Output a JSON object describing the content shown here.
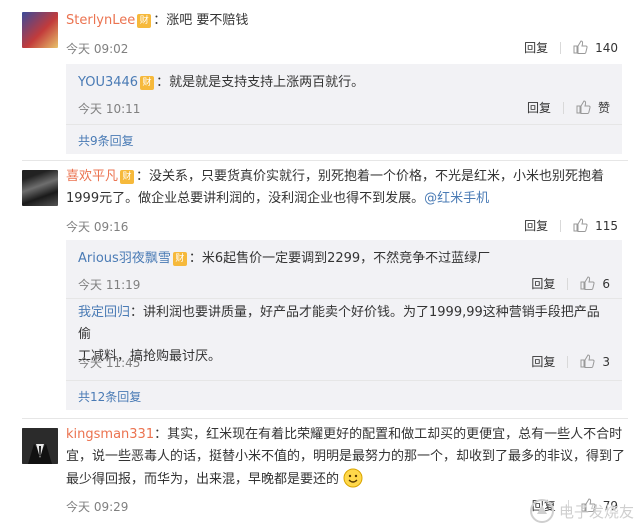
{
  "comments": [
    {
      "user": "SterlynLee",
      "text": "：涨吧 要不赔钱",
      "time": "今天 09:02",
      "reply": "回复",
      "likes": "140"
    },
    {
      "user": "喜欢平凡",
      "text_line1": "：没关系，只要货真价实就行，别死抱着一个价格，不光是红米，小米也别死抱着",
      "text_line2": "1999元了。做企业总要讲利润的，没利润企业也得不到发展。",
      "mention": "@红米手机",
      "time": "今天 09:16",
      "reply": "回复",
      "likes": "115"
    },
    {
      "user": "kingsman331",
      "text_line1": "：其实，红米现在有着比荣耀更好的配置和做工却买的更便宜，总有一些人不合时",
      "text_line2": "宜，说一些恶毒人的话，挺替小米不值的，明明是最努力的那一个，却收到了最多的非议，得到了",
      "text_line3": "最少得回报，而华为，出来混，早晚都是要还的",
      "time": "今天 09:29",
      "reply": "回复",
      "likes": "79"
    }
  ],
  "sub_replies": [
    {
      "user": "YOU3446",
      "text": "：就是就是支持支持上涨两百就行。",
      "time": "今天 10:11",
      "reply": "回复",
      "likes": "赞"
    },
    {
      "user": "Arious羽夜飘雪",
      "text": "：米6起售价一定要调到2299，不然竞争不过蓝绿厂",
      "time": "今天 11:19",
      "reply": "回复",
      "likes": "6"
    },
    {
      "user": "我定回归",
      "text_line1": "：讲利润也要讲质量，好产品才能卖个好价钱。为了1999,99这种营销手段把产品偷",
      "text_line2": "工减料，搞抢购最讨厌。",
      "time": "今天 11:45",
      "reply": "回复",
      "likes": "3"
    }
  ],
  "more_links": {
    "first": "共9条回复",
    "second": "共12条回复"
  },
  "badge_icon": "fortune-badge-icon",
  "watermark": "电子发烧友",
  "colors": {
    "username": "#eb7350",
    "link": "#4a7bb5",
    "reply_bg": "#f2f2f5",
    "badge": "#f6b93b"
  }
}
